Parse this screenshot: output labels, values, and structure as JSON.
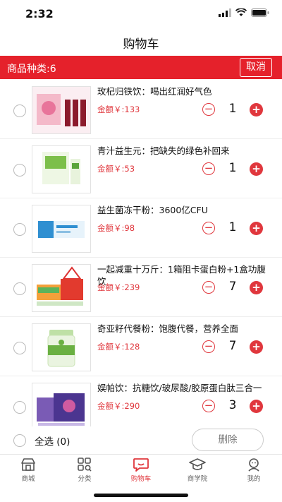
{
  "status_bar": {
    "time": "2:32"
  },
  "nav": {
    "title": "购物车"
  },
  "cart_bar": {
    "category_count": "商品种类:6",
    "cancel_label": "取消"
  },
  "items": [
    {
      "name": "玫杞归铁饮：喝出红润好气色",
      "price": "金额￥:133",
      "qty": "1",
      "minus": "−",
      "plus": "+"
    },
    {
      "name": "青汁益生元：把缺失的绿色补回来",
      "price": "金额￥:53",
      "qty": "1",
      "minus": "−",
      "plus": "+"
    },
    {
      "name": "益生菌冻干粉：3600亿CFU",
      "price": "金额￥:98",
      "qty": "1",
      "minus": "−",
      "plus": "+"
    },
    {
      "name": "一起减重十万斤：1箱阻卡蛋白粉+1盒功腹饮",
      "price": "金额￥:239",
      "qty": "7",
      "minus": "−",
      "plus": "+"
    },
    {
      "name": "奇亚籽代餐粉：饱腹代餐，营养全面",
      "price": "金额￥:128",
      "qty": "7",
      "minus": "−",
      "plus": "+"
    },
    {
      "name": "娱帕饮：抗糖饮/玻尿酸/胶原蛋白肽三合一",
      "price": "金额￥:290",
      "qty": "3",
      "minus": "−",
      "plus": "+"
    }
  ],
  "bottom": {
    "select_all": "全选 (0)",
    "delete_label": "删除"
  },
  "tabs": [
    {
      "label": "商城",
      "icon": "store-icon"
    },
    {
      "label": "分类",
      "icon": "category-icon"
    },
    {
      "label": "购物车",
      "icon": "cart-icon"
    },
    {
      "label": "商学院",
      "icon": "graduation-cap-icon"
    },
    {
      "label": "我的",
      "icon": "profile-icon"
    }
  ],
  "colors": {
    "brand_red": "#e5212b",
    "price_red": "#e0373d"
  }
}
